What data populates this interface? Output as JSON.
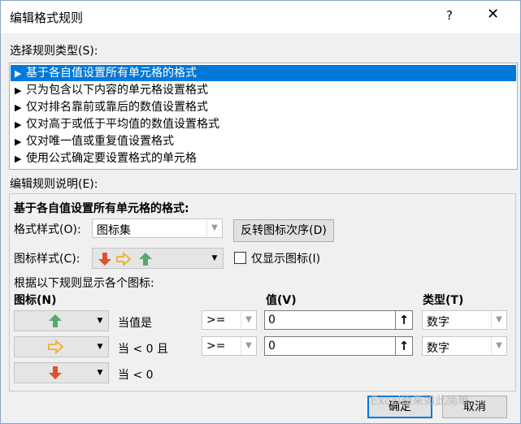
{
  "dialog": {
    "title": "编辑格式规则",
    "help": "?",
    "close": "✕"
  },
  "rule_type": {
    "label": "选择规则类型(S):",
    "items": [
      "基于各自值设置所有单元格的格式",
      "只为包含以下内容的单元格设置格式",
      "仅对排名靠前或靠后的数值设置格式",
      "仅对高于或低于平均值的数值设置格式",
      "仅对唯一值或重复值设置格式",
      "使用公式确定要设置格式的单元格"
    ],
    "selected_index": 0
  },
  "description": {
    "label": "编辑规则说明(E):",
    "heading": "基于各自值设置所有单元格的格式:",
    "format_style_label": "格式样式(O):",
    "format_style_value": "图标集",
    "reverse_button": "反转图标次序(D)",
    "icon_style_label": "图标样式(C):",
    "show_icon_only_label": "仅显示图标(I)",
    "show_icon_only_checked": false,
    "rules_caption": "根据以下规则显示各个图标:",
    "col_icon": "图标(N)",
    "col_value": "值(V)",
    "col_type": "类型(T)",
    "rows": [
      {
        "icon": "green-up-arrow-icon",
        "condition": "当值是",
        "operator": ">=",
        "value": "0",
        "type": "数字"
      },
      {
        "icon": "yellow-right-arrow-icon",
        "condition": "当 < 0 且",
        "operator": ">=",
        "value": "0",
        "type": "数字"
      },
      {
        "icon": "red-down-arrow-icon",
        "condition": "当 < 0"
      }
    ]
  },
  "footer": {
    "ok": "确定",
    "cancel": "取消"
  },
  "watermark": "Excel原来如此简单",
  "colors": {
    "selection": "#0078d7",
    "arrow_green": "#5aa870",
    "arrow_yellow": "#f0b23a",
    "arrow_red": "#e0522e"
  }
}
